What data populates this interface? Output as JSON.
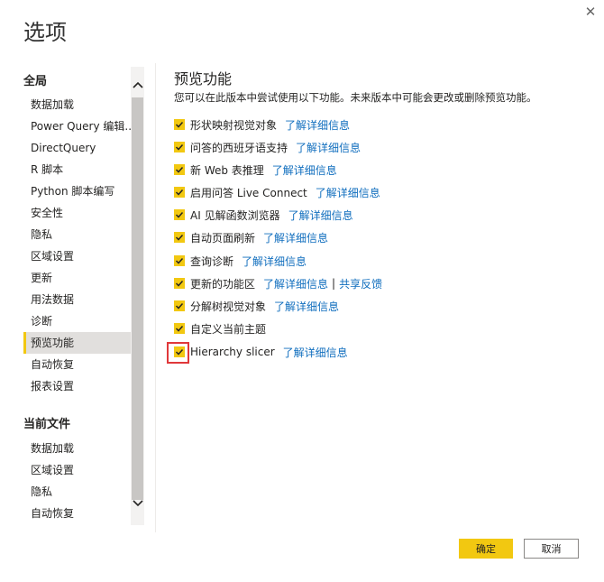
{
  "dialog": {
    "title": "选项",
    "close_icon": "close-icon"
  },
  "sidebar": {
    "global_header": "全局",
    "global_items": [
      {
        "label": "数据加载"
      },
      {
        "label": "Power Query 编辑..."
      },
      {
        "label": "DirectQuery"
      },
      {
        "label": "R 脚本"
      },
      {
        "label": "Python 脚本编写"
      },
      {
        "label": "安全性"
      },
      {
        "label": "隐私"
      },
      {
        "label": "区域设置"
      },
      {
        "label": "更新"
      },
      {
        "label": "用法数据"
      },
      {
        "label": "诊断"
      },
      {
        "label": "预览功能",
        "selected": true
      },
      {
        "label": "自动恢复"
      },
      {
        "label": "报表设置"
      }
    ],
    "file_header": "当前文件",
    "file_items": [
      {
        "label": "数据加载"
      },
      {
        "label": "区域设置"
      },
      {
        "label": "隐私"
      },
      {
        "label": "自动恢复"
      }
    ]
  },
  "content": {
    "title": "预览功能",
    "description": "您可以在此版本中尝试使用以下功能。未来版本中可能会更改或删除预览功能。",
    "features": [
      {
        "label": "形状映射视觉对象",
        "checked": true,
        "link": "了解详细信息"
      },
      {
        "label": "问答的西班牙语支持",
        "checked": true,
        "link": "了解详细信息"
      },
      {
        "label": "新 Web 表推理",
        "checked": true,
        "link": "了解详细信息"
      },
      {
        "label": "启用问答 Live Connect",
        "checked": true,
        "link": "了解详细信息"
      },
      {
        "label": "AI 见解函数浏览器",
        "checked": true,
        "link": "了解详细信息"
      },
      {
        "label": "自动页面刷新",
        "checked": true,
        "link": "了解详细信息"
      },
      {
        "label": "查询诊断",
        "checked": true,
        "link": "了解详细信息"
      },
      {
        "label": "更新的功能区",
        "checked": true,
        "link": "了解详细信息",
        "separator": "|",
        "link2": "共享反馈"
      },
      {
        "label": "分解树视觉对象",
        "checked": true,
        "link": "了解详细信息"
      },
      {
        "label": "自定义当前主题",
        "checked": true,
        "link": ""
      },
      {
        "label": "Hierarchy slicer",
        "checked": true,
        "link": "了解详细信息"
      }
    ]
  },
  "buttons": {
    "ok": "确定",
    "cancel": "取消"
  },
  "colors": {
    "accent": "#f2c811",
    "link": "#106ebe",
    "highlight": "#e0383a"
  }
}
